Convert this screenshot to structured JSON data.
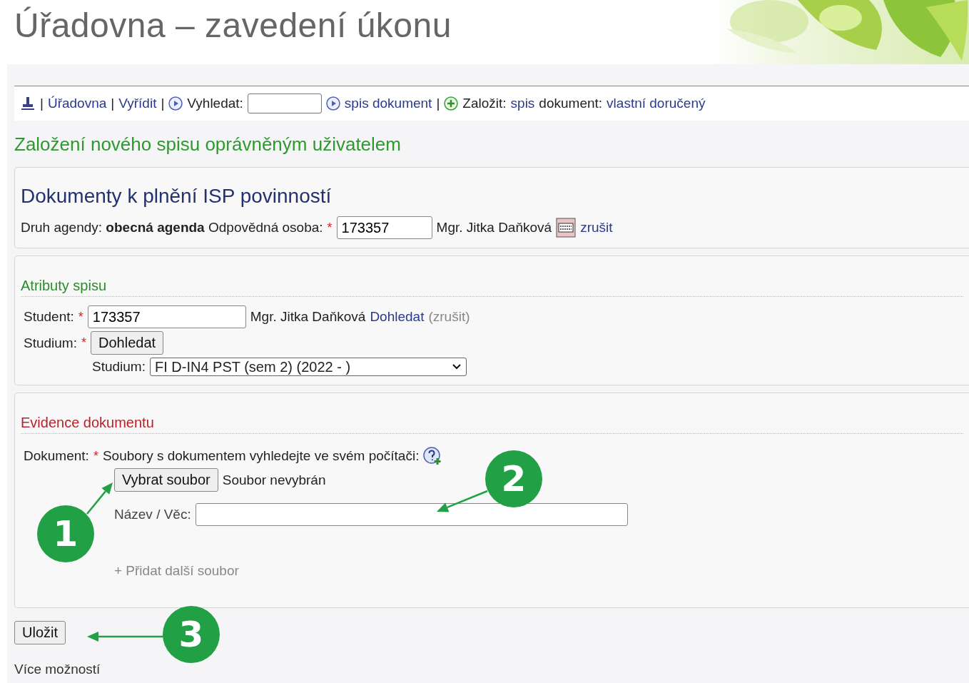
{
  "header": {
    "title": "Úřadovna – zavedení úkonu"
  },
  "nav": {
    "items": [
      {
        "kind": "sep",
        "text": "|"
      },
      {
        "kind": "link",
        "text": "Úřadovna"
      },
      {
        "kind": "sep",
        "text": "|"
      },
      {
        "kind": "link",
        "text": "Vyřídit"
      },
      {
        "kind": "sep",
        "text": "|"
      }
    ],
    "search": {
      "label": "Vyhledat:",
      "link": "spis dokument"
    },
    "trail": [
      {
        "kind": "sep",
        "text": "|"
      },
      {
        "kind": "plain",
        "text": "Založit:"
      },
      {
        "kind": "link",
        "text": "spis"
      },
      {
        "kind": "plain",
        "text": "dokument:"
      },
      {
        "kind": "link",
        "text": "vlastní doručený"
      }
    ]
  },
  "page_heading": "Založení nového spisu oprávněným uživatelem",
  "agenda": {
    "title": "Dokumenty k plnění ISP povinností",
    "text": "Druh agendy: **obecná agenda** Odpovědná osoba:",
    "required": "*",
    "person_value": "173357",
    "person_name": "Mgr. Jitka Daňková",
    "cancel": "zrušit"
  },
  "attributes": {
    "title": "Atributy spisu",
    "student_label": "Student:",
    "student_required": "*",
    "student_value": "173357",
    "student_name": "Mgr. Jitka Daňková",
    "student_lookup": "Dohledat",
    "student_cancel": "(zrušit)",
    "study_label": "Studium:",
    "study_required": "*",
    "study_button": "Dohledat",
    "study_select_label": "Studium:",
    "study_select_value": "FI D-IN4 PST (sem 2) (2022 - )"
  },
  "evidence": {
    "title": "Evidence dokumentu",
    "document_label": "Dokument:",
    "required": "*",
    "hint": "Soubory s dokumentem vyhledejte ve svém počítači:",
    "file_button": "Vybrat soubor",
    "file_status": "Soubor nevybrán",
    "name_label": "Název / Věc:",
    "add_file": "+ Přidat další soubor"
  },
  "save_button": "Uložit",
  "more_options": "Více možností",
  "annotations": [
    {
      "label": "1"
    },
    {
      "label": "2"
    },
    {
      "label": "3"
    }
  ]
}
